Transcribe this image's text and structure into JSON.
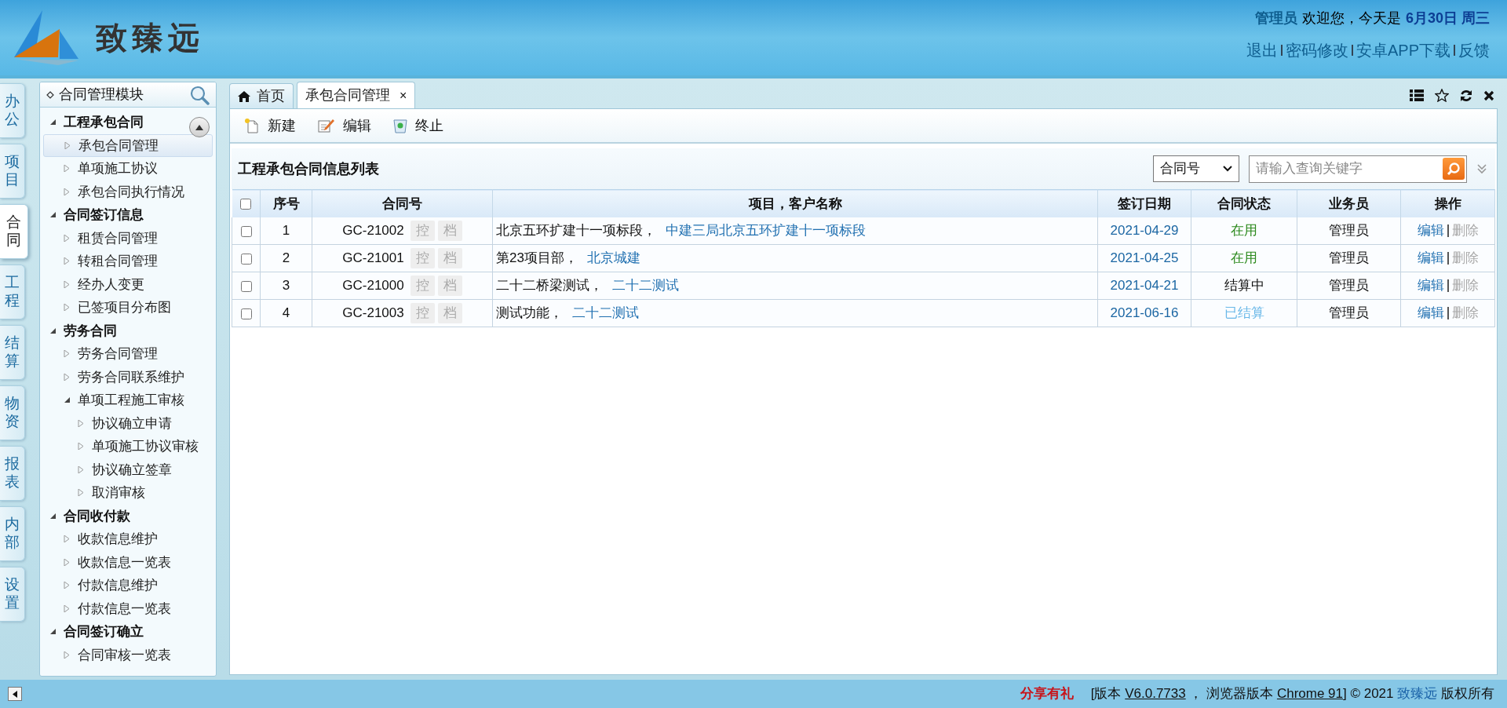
{
  "header": {
    "logo_text": "致臻远",
    "user": "管理员",
    "greeting": "欢迎您，今天是",
    "date": "6月30日 周三",
    "links": [
      "退出",
      "密码修改",
      "安卓APP下载",
      "反馈"
    ]
  },
  "side_tabs": [
    {
      "label": "办公",
      "selected": false
    },
    {
      "label": "项目",
      "selected": false
    },
    {
      "label": "合同",
      "selected": true
    },
    {
      "label": "工程",
      "selected": false
    },
    {
      "label": "结算",
      "selected": false
    },
    {
      "label": "物资",
      "selected": false
    },
    {
      "label": "报表",
      "selected": false
    },
    {
      "label": "内部",
      "selected": false
    },
    {
      "label": "设置",
      "selected": false
    }
  ],
  "sidebar": {
    "title": "合同管理模块",
    "items": [
      {
        "label": "工程承包合同",
        "expanded": true,
        "children": [
          {
            "label": "承包合同管理",
            "selected": true
          },
          {
            "label": "单项施工协议",
            "selected": false
          },
          {
            "label": "承包合同执行情况",
            "selected": false
          }
        ]
      },
      {
        "label": "合同签订信息",
        "expanded": true,
        "children": [
          {
            "label": "租赁合同管理",
            "selected": false
          },
          {
            "label": "转租合同管理",
            "selected": false
          },
          {
            "label": "经办人变更",
            "selected": false
          },
          {
            "label": "已签项目分布图",
            "selected": false
          }
        ]
      },
      {
        "label": "劳务合同",
        "expanded": true,
        "children": [
          {
            "label": "劳务合同管理",
            "selected": false
          },
          {
            "label": "劳务合同联系维护",
            "selected": false
          },
          {
            "label": "单项工程施工审核",
            "selected": false,
            "expanded": true,
            "children": [
              {
                "label": "协议确立申请",
                "selected": false
              },
              {
                "label": "单项施工协议审核",
                "selected": false
              },
              {
                "label": "协议确立签章",
                "selected": false
              },
              {
                "label": "取消审核",
                "selected": false
              }
            ]
          }
        ]
      },
      {
        "label": "合同收付款",
        "expanded": true,
        "children": [
          {
            "label": "收款信息维护",
            "selected": false
          },
          {
            "label": "收款信息一览表",
            "selected": false
          },
          {
            "label": "付款信息维护",
            "selected": false
          },
          {
            "label": "付款信息一览表",
            "selected": false
          }
        ]
      },
      {
        "label": "合同签订确立",
        "expanded": true,
        "children": [
          {
            "label": "合同审核一览表",
            "selected": false
          }
        ]
      }
    ]
  },
  "tabs": [
    {
      "label": "首页",
      "selected": false,
      "closable": false
    },
    {
      "label": "承包合同管理",
      "selected": true,
      "closable": true
    }
  ],
  "tab_close": "×",
  "toolbar": [
    {
      "kind": "new",
      "label": "新建"
    },
    {
      "kind": "edit",
      "label": "编辑"
    },
    {
      "kind": "stop",
      "label": "终止"
    }
  ],
  "list": {
    "title": "工程承包合同信息列表",
    "all_checked": false,
    "filter": "合同号",
    "search_placeholder": "请输入查询关键字",
    "columns": [
      "序号",
      "合同号",
      "项目，客户名称",
      "签订日期",
      "合同状态",
      "业务员",
      "操作"
    ],
    "rows": [
      {
        "checked": false,
        "no": "1",
        "code": "GC-21002",
        "tags": [
          "控",
          "档"
        ],
        "project": "北京五环扩建十一项标段，",
        "client": "中建三局北京五环扩建十一项标段",
        "date": "2021-04-29",
        "status": {
          "label": "在用",
          "color": "#2d8a1e"
        },
        "staff": "管理员",
        "actions": [
          "编辑",
          "删除"
        ]
      },
      {
        "checked": false,
        "no": "2",
        "code": "GC-21001",
        "tags": [
          "控",
          "档"
        ],
        "project": "第23项目部，",
        "client": "北京城建",
        "date": "2021-04-25",
        "status": {
          "label": "在用",
          "color": "#2d8a1e"
        },
        "staff": "管理员",
        "actions": [
          "编辑",
          "删除"
        ]
      },
      {
        "checked": false,
        "no": "3",
        "code": "GC-21000",
        "tags": [
          "控",
          "档"
        ],
        "project": "二十二桥梁测试，",
        "client": "二十二测试",
        "date": "2021-04-21",
        "status": {
          "label": "结算中",
          "color": "#111111"
        },
        "staff": "管理员",
        "actions": [
          "编辑",
          "删除"
        ]
      },
      {
        "checked": false,
        "no": "4",
        "code": "GC-21003",
        "tags": [
          "控",
          "档"
        ],
        "project": "测试功能，",
        "client": "二十二测试",
        "date": "2021-06-16",
        "status": {
          "label": "已结算",
          "color": "#6ab8e8"
        },
        "staff": "管理员",
        "actions": [
          "编辑",
          "删除"
        ]
      }
    ]
  },
  "footer": {
    "promo": "分享有礼",
    "prefix": "[版本",
    "version": "V6.0.7733",
    "middle": "， 浏览器版本",
    "browser": "Chrome 91",
    "suffix": "] © 2021",
    "brand": "致臻远",
    "tail": "版权所有"
  }
}
